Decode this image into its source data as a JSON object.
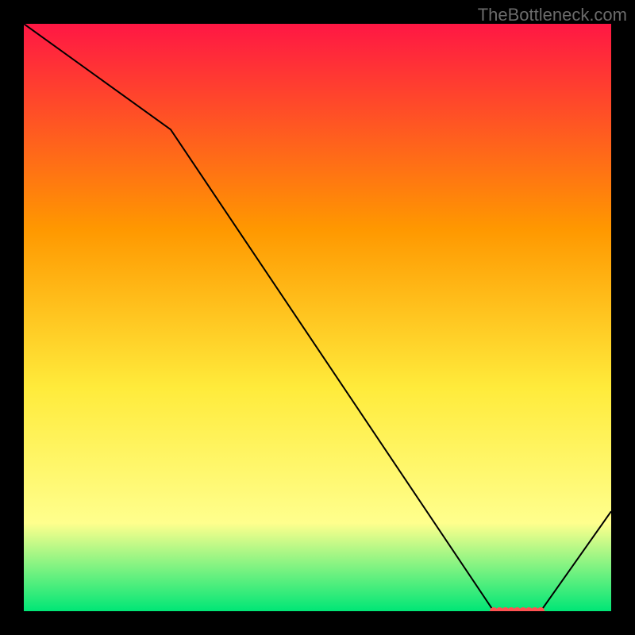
{
  "watermark": "TheBottleneck.com",
  "chart_data": {
    "type": "line",
    "title": "",
    "xlabel": "",
    "ylabel": "",
    "xlim": [
      0,
      100
    ],
    "ylim": [
      0,
      100
    ],
    "background_gradient": {
      "top": "#ff1744",
      "mid_upper": "#ff9800",
      "mid": "#ffeb3b",
      "mid_lower": "#ffff8d",
      "bottom": "#00e676"
    },
    "x": [
      0,
      25,
      80,
      88,
      100
    ],
    "values": [
      100,
      82,
      0,
      0,
      17
    ],
    "markers_x": [
      80,
      81,
      82,
      83,
      84,
      85,
      86,
      87,
      88
    ],
    "markers_y": [
      0,
      0,
      0,
      0,
      0,
      0,
      0,
      0,
      0
    ],
    "marker_color": "#ff5252"
  }
}
